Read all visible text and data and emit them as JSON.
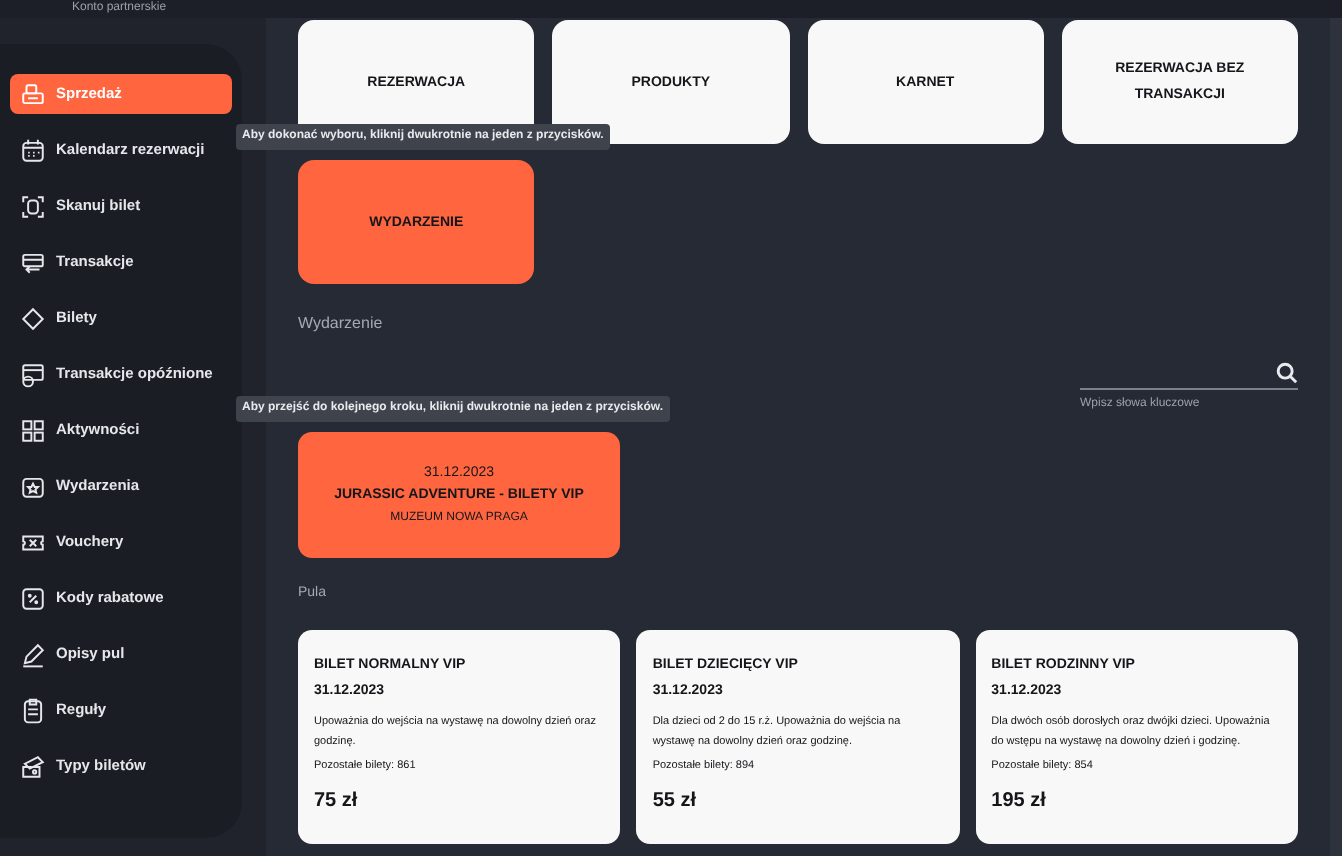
{
  "header": {
    "title": "Konto partnerskie"
  },
  "sidebar": {
    "items": [
      {
        "label": "Sprzedaż",
        "selected": true
      },
      {
        "label": "Kalendarz rezerwacji",
        "selected": false
      },
      {
        "label": "Skanuj bilet",
        "selected": false
      },
      {
        "label": "Transakcje",
        "selected": false
      },
      {
        "label": "Bilety",
        "selected": false
      },
      {
        "label": "Transakcje opóźnione",
        "selected": false
      },
      {
        "label": "Aktywności",
        "selected": false
      },
      {
        "label": "Wydarzenia",
        "selected": false
      },
      {
        "label": "Vouchery",
        "selected": false
      },
      {
        "label": "Kody rabatowe",
        "selected": false
      },
      {
        "label": "Opisy pul",
        "selected": false
      },
      {
        "label": "Reguły",
        "selected": false
      },
      {
        "label": "Typy biletów",
        "selected": false
      }
    ]
  },
  "sale_types": [
    {
      "label": "REZERWACJA",
      "selected": false
    },
    {
      "label": "PRODUKTY",
      "selected": false
    },
    {
      "label": "KARNET",
      "selected": false
    },
    {
      "label": "REZERWACJA BEZ TRANSAKCJI",
      "selected": false
    },
    {
      "label": "WYDARZENIE",
      "selected": true
    }
  ],
  "tooltips": [
    "Aby dokonać wyboru, kliknij dwukrotnie na jeden z przycisków.",
    "Aby przejść do kolejnego kroku, kliknij dwukrotnie na jeden z przycisków."
  ],
  "event_section": {
    "title": "Wydarzenie",
    "search": {
      "placeholder": "Wpisz słowa kluczowe"
    },
    "events": [
      {
        "date": "31.12.2023",
        "name": "JURASSIC ADVENTURE - BILETY VIP",
        "venue": "MUZEUM NOWA PRAGA",
        "selected": true
      }
    ]
  },
  "pool_section": {
    "title": "Pula",
    "tickets": [
      {
        "name": "BILET NORMALNY VIP",
        "date": "31.12.2023",
        "description": "Upoważnia do wejścia na wystawę na dowolny dzień oraz godzinę.",
        "remaining": "Pozostałe bilety: 861",
        "price": "75 zł"
      },
      {
        "name": "BILET DZIECIĘCY VIP",
        "date": "31.12.2023",
        "description": "Dla dzieci od 2 do 15 r.ż. Upoważnia do wejścia na wystawę na dowolny dzień oraz godzinę.",
        "remaining": "Pozostałe bilety: 894",
        "price": "55 zł"
      },
      {
        "name": "BILET RODZINNY VIP",
        "date": "31.12.2023",
        "description": "Dla dwóch osób dorosłych oraz dwójki dzieci. Upoważnia do wstępu na wystawę na dowolny dzień i godzinę.",
        "remaining": "Pozostałe bilety: 854",
        "price": "195 zł"
      }
    ]
  }
}
